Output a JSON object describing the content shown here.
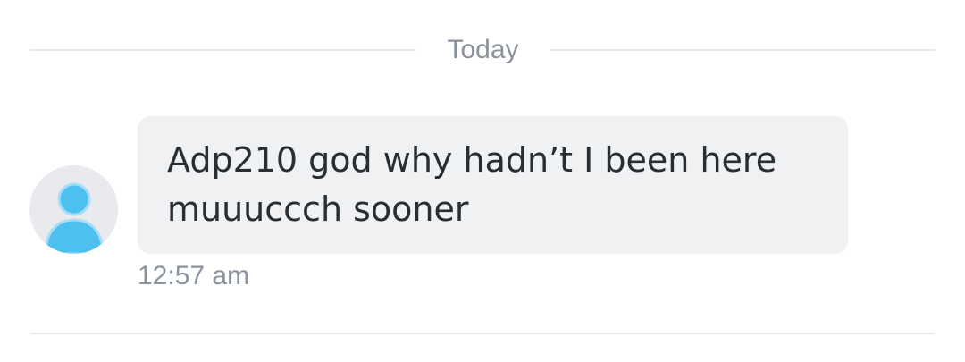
{
  "divider": {
    "label": "Today"
  },
  "message": {
    "avatar_icon": "user-avatar-icon",
    "text": "Adp210 god why hadn’t I been here muuuccch sooner",
    "time": "12:57 am"
  },
  "colors": {
    "avatar_accent": "#4ec0f0",
    "bubble_background": "#f0f1f3",
    "muted_text": "#8a929c"
  }
}
